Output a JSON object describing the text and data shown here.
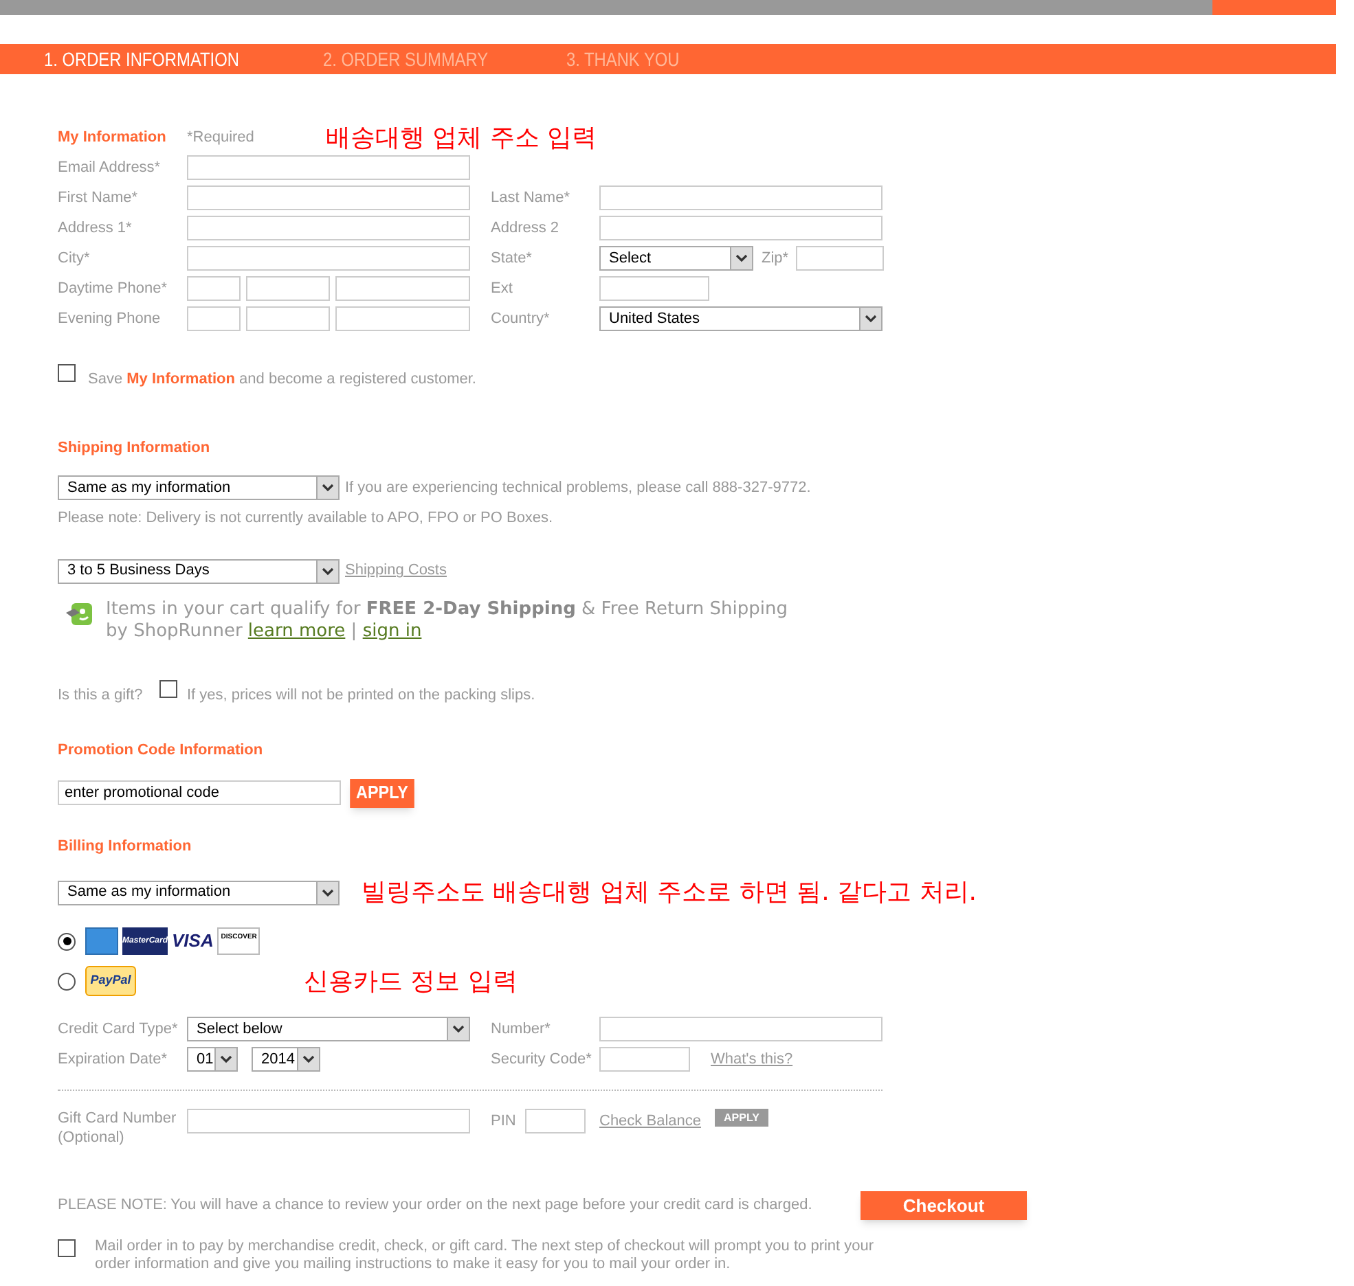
{
  "steps": [
    {
      "label": "1. ORDER INFORMATION",
      "selected": true
    },
    {
      "label": "2. ORDER SUMMARY",
      "selected": false
    },
    {
      "label": "3. THANK YOU",
      "selected": false
    }
  ],
  "my_information": {
    "title": "My Information",
    "required_note": "*Required",
    "annotation": "배송대행 업체 주소 입력",
    "rows": [
      {
        "left": {
          "label": "Email Address*",
          "kind": "text"
        }
      },
      {
        "left": {
          "label": "First Name*",
          "kind": "text"
        },
        "right": {
          "label": "Last Name*",
          "kind": "text"
        }
      },
      {
        "left": {
          "label": "Address 1*",
          "kind": "text"
        },
        "right": {
          "label": "Address 2",
          "kind": "text"
        }
      },
      {
        "left": {
          "label": "City*",
          "kind": "text"
        },
        "right": {
          "label": "State*",
          "kind": "state_zip",
          "value": "Select",
          "zip_label": "Zip*"
        }
      },
      {
        "left": {
          "label": "Daytime Phone*",
          "kind": "phone"
        },
        "right": {
          "label": "Ext",
          "kind": "short"
        }
      },
      {
        "left": {
          "label": "Evening Phone",
          "kind": "phone"
        },
        "right": {
          "label": "Country*",
          "kind": "select",
          "value": "United States"
        }
      }
    ],
    "save": {
      "checked": false,
      "text": "Save **My Information** and become a registered customer."
    }
  },
  "shipping": {
    "title": "Shipping Information",
    "address_select": "Same as my information",
    "tech_note": "If you are experiencing technical problems, please call 888-327-9772.",
    "delivery_note": "Please note: Delivery is not currently available to APO, FPO or PO Boxes.",
    "speed_select": "3 to 5 Business Days",
    "costs_link": "Shipping Costs",
    "shoprunner": {
      "text": "Items in your cart qualify for **FREE 2-Day Shipping** & Free Return Shipping by ShopRunner",
      "learn_more": "learn more",
      "separator": "|",
      "sign_in": "sign in"
    }
  },
  "gift": {
    "label": "Is this a gift?",
    "checked": false,
    "note": "If yes, prices will not be printed on the packing slips."
  },
  "promotion": {
    "title": "Promotion Code Information",
    "value": "enter promotional code",
    "button": "APPLY"
  },
  "billing": {
    "title": "Billing Information",
    "address_select": "Same as my information",
    "annotation": "빌링주소도 배송대행 업체 주소로 하면 됨. 같다고 처리.",
    "payment_options": [
      {
        "kind": "cards",
        "selected": true,
        "logos": [
          {
            "kind": "amex"
          },
          {
            "kind": "mastercard",
            "text": "MasterCard"
          },
          {
            "kind": "visa",
            "text": "VISA"
          },
          {
            "kind": "discover",
            "text": "DISCOVER"
          }
        ]
      },
      {
        "kind": "paypal",
        "selected": false,
        "text": "PayPal",
        "annotation": "신용카드 정보 입력"
      }
    ],
    "card_type_label": "Credit Card Type*",
    "card_type_value": "Select below",
    "number_label": "Number*",
    "expiration_label": "Expiration Date*",
    "month": "01",
    "year": "2014",
    "security_label": "Security Code*",
    "whats_this": "What's this?",
    "gift_card_label": "Gift Card Number",
    "gift_card_optional": "(Optional)",
    "pin_label": "PIN",
    "check_balance": "Check Balance",
    "gift_apply": "APPLY"
  },
  "please_note": {
    "label": "PLEASE NOTE:",
    "text": "You will have a chance to review your order on the next page before your credit card is charged.",
    "button": "Checkout"
  },
  "mail_order": {
    "checked": false,
    "text": "Mail order in to pay by merchandise credit, check, or gift card. The next step of checkout will prompt you to print your order information and give you mailing instructions to make it easy for you to mail your order in."
  }
}
